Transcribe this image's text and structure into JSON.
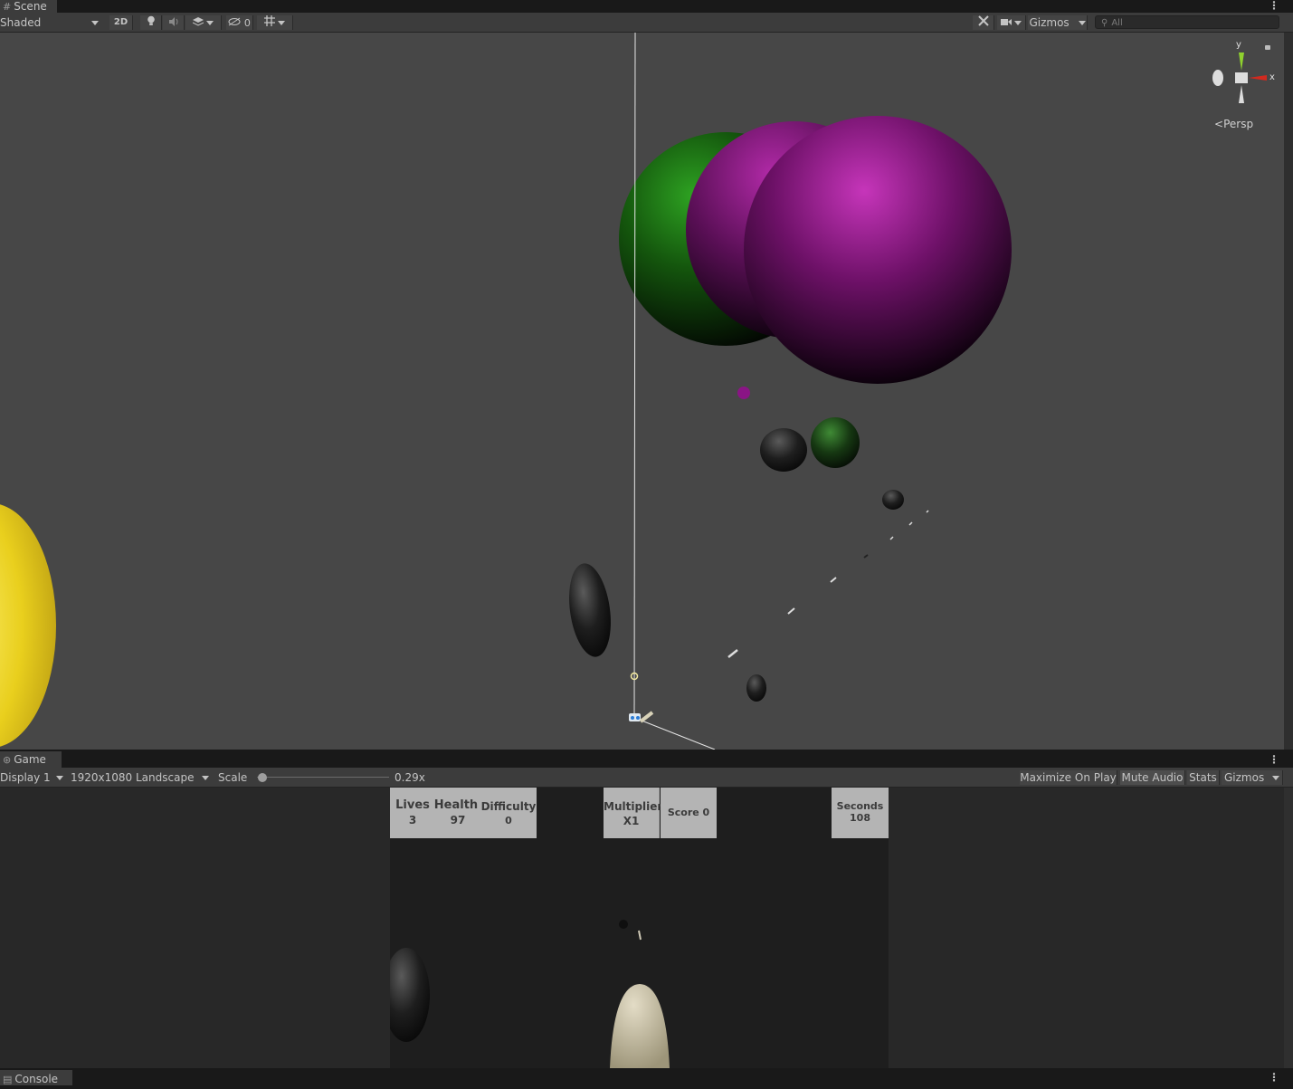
{
  "scene": {
    "tab_label": "Scene",
    "shading_mode": "Shaded",
    "mode_2d_label": "2D",
    "hidden_count": "0",
    "gizmos_label": "Gizmos",
    "search_placeholder": "All",
    "axis_y": "y",
    "axis_x": "x",
    "projection_label": "Persp"
  },
  "game": {
    "tab_label": "Game",
    "display": "Display 1",
    "resolution": "1920x1080 Landscape",
    "scale_label": "Scale",
    "scale_value": "0.29x",
    "scale_fraction": 0.02,
    "maximize_label": "Maximize On Play",
    "mute_label": "Mute Audio",
    "stats_label": "Stats",
    "gizmos_label": "Gizmos",
    "hud": {
      "lives_label": "Lives",
      "lives_value": "3",
      "health_label": "Health",
      "health_value": "97",
      "difficulty_label": "Difficulty",
      "difficulty_value": "0",
      "multiplier_label": "Multiplier",
      "multiplier_value": "X1",
      "score_text": "Score 0",
      "seconds_label": "Seconds",
      "seconds_value": "108"
    }
  },
  "console": {
    "tab_label": "Console"
  },
  "colors": {
    "scene_bg": "#474747",
    "toolbar_bg": "#3c3c3c",
    "planet_green": "#1a6e12",
    "planet_magenta": "#8a1585",
    "sun_yellow": "#f3e22a",
    "hud_panel": "#b4b4b4"
  }
}
